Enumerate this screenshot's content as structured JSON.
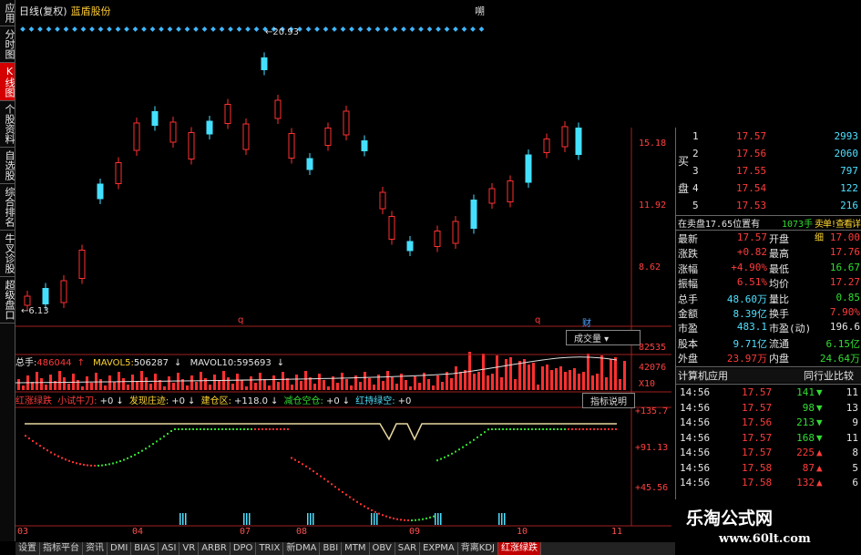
{
  "left_menu": [
    "应用",
    "分时图",
    "K线图",
    "个股资料",
    "自选股",
    "综合排名",
    "牛叉诊股",
    "超级盘口"
  ],
  "left_menu_active": 2,
  "chart": {
    "period": "日线(复权)",
    "stock_name": "蓝盾股份",
    "top_right": "嗍",
    "price_high_label": "20.93",
    "price_low_label": "6.13",
    "price_axis": [
      "15.18",
      "11.92",
      "8.62"
    ],
    "event_marks": [
      "q",
      "q",
      "财"
    ],
    "volume": {
      "label": "总手:",
      "value": "486044",
      "ma5_label": "MAVOL5:",
      "ma5": "506287",
      "ma10_label": "MAVOL10:",
      "ma10": "595693",
      "axis": [
        "82535",
        "42076",
        "X10"
      ],
      "dropdown": "成交量"
    },
    "indicator": {
      "name": "红涨绿跌",
      "items": [
        {
          "label": "小试牛刀:",
          "value": "+0"
        },
        {
          "label": "发现庄迹:",
          "value": "+0"
        },
        {
          "label": "建仓区:",
          "value": "+118.0"
        },
        {
          "label": "减仓空仓:",
          "value": "+0"
        },
        {
          "label": "红持绿空:",
          "value": "+0"
        }
      ],
      "button": "指标说明",
      "axis": [
        "+135.7",
        "+91.13",
        "+45.56"
      ]
    },
    "months": [
      "03",
      "04",
      "07",
      "08",
      "09",
      "10",
      "11"
    ]
  },
  "tabs": [
    "设置",
    "指标平台",
    "资讯",
    "DMI",
    "BIAS",
    "ASI",
    "VR",
    "ARBR",
    "DPO",
    "TRIX",
    "新DMA",
    "BBI",
    "MTM",
    "OBV",
    "SAR",
    "EXPMA",
    "背离KDJ",
    "红涨绿跌"
  ],
  "tabs_active": 17,
  "quote_panel": {
    "bid_label_1": "买",
    "bid_label_2": "盘",
    "bids": [
      {
        "level": "1",
        "price": "17.57",
        "vol": "2993"
      },
      {
        "level": "2",
        "price": "17.56",
        "vol": "2060"
      },
      {
        "level": "3",
        "price": "17.55",
        "vol": "797"
      },
      {
        "level": "4",
        "price": "17.54",
        "vol": "122"
      },
      {
        "level": "5",
        "price": "17.53",
        "vol": "216"
      }
    ],
    "notice": "在卖盘17.65位置有",
    "notice_vol": "1073手",
    "notice_tail": "卖单!查看详细",
    "stats": [
      {
        "l1": "最新",
        "v1": "17.57",
        "l2": "开盘",
        "v2": "17.00"
      },
      {
        "l1": "涨跌",
        "v1": "+0.82",
        "l2": "最高",
        "v2": "17.76"
      },
      {
        "l1": "涨幅",
        "v1": "+4.90%",
        "l2": "最低",
        "v2": "16.67"
      },
      {
        "l1": "振幅",
        "v1": "6.51%",
        "l2": "均价",
        "v2": "17.27"
      },
      {
        "l1": "总手",
        "v1": "48.60万",
        "l2": "量比",
        "v2": "0.85"
      },
      {
        "l1": "金额",
        "v1": "8.39亿",
        "l2": "换手",
        "v2": "7.90%"
      },
      {
        "l1": "市盈",
        "v1": "483.1",
        "l2": "市盈(动)",
        "v2": "196.6"
      },
      {
        "l1": "股本",
        "v1": "9.71亿",
        "l2": "流通",
        "v2": "6.15亿"
      },
      {
        "l1": "外盘",
        "v1": "23.97万",
        "l2": "内盘",
        "v2": "24.64万"
      }
    ],
    "industry": "计算机应用",
    "industry_compare": "同行业比较",
    "ticks": [
      {
        "time": "14:56",
        "price": "17.57",
        "vol": "141",
        "dir": "down",
        "n": "11"
      },
      {
        "time": "14:56",
        "price": "17.57",
        "vol": "98",
        "dir": "down",
        "n": "13"
      },
      {
        "time": "14:56",
        "price": "17.56",
        "vol": "213",
        "dir": "down",
        "n": "9"
      },
      {
        "time": "14:56",
        "price": "17.57",
        "vol": "168",
        "dir": "down",
        "n": "11"
      },
      {
        "time": "14:56",
        "price": "17.57",
        "vol": "225",
        "dir": "up",
        "n": "8"
      },
      {
        "time": "14:56",
        "price": "17.58",
        "vol": "87",
        "dir": "up",
        "n": "5"
      },
      {
        "time": "14:56",
        "price": "17.58",
        "vol": "132",
        "dir": "up",
        "n": "6"
      }
    ]
  },
  "watermark": {
    "title": "乐淘公式网",
    "url": "www.60lt.com"
  }
}
